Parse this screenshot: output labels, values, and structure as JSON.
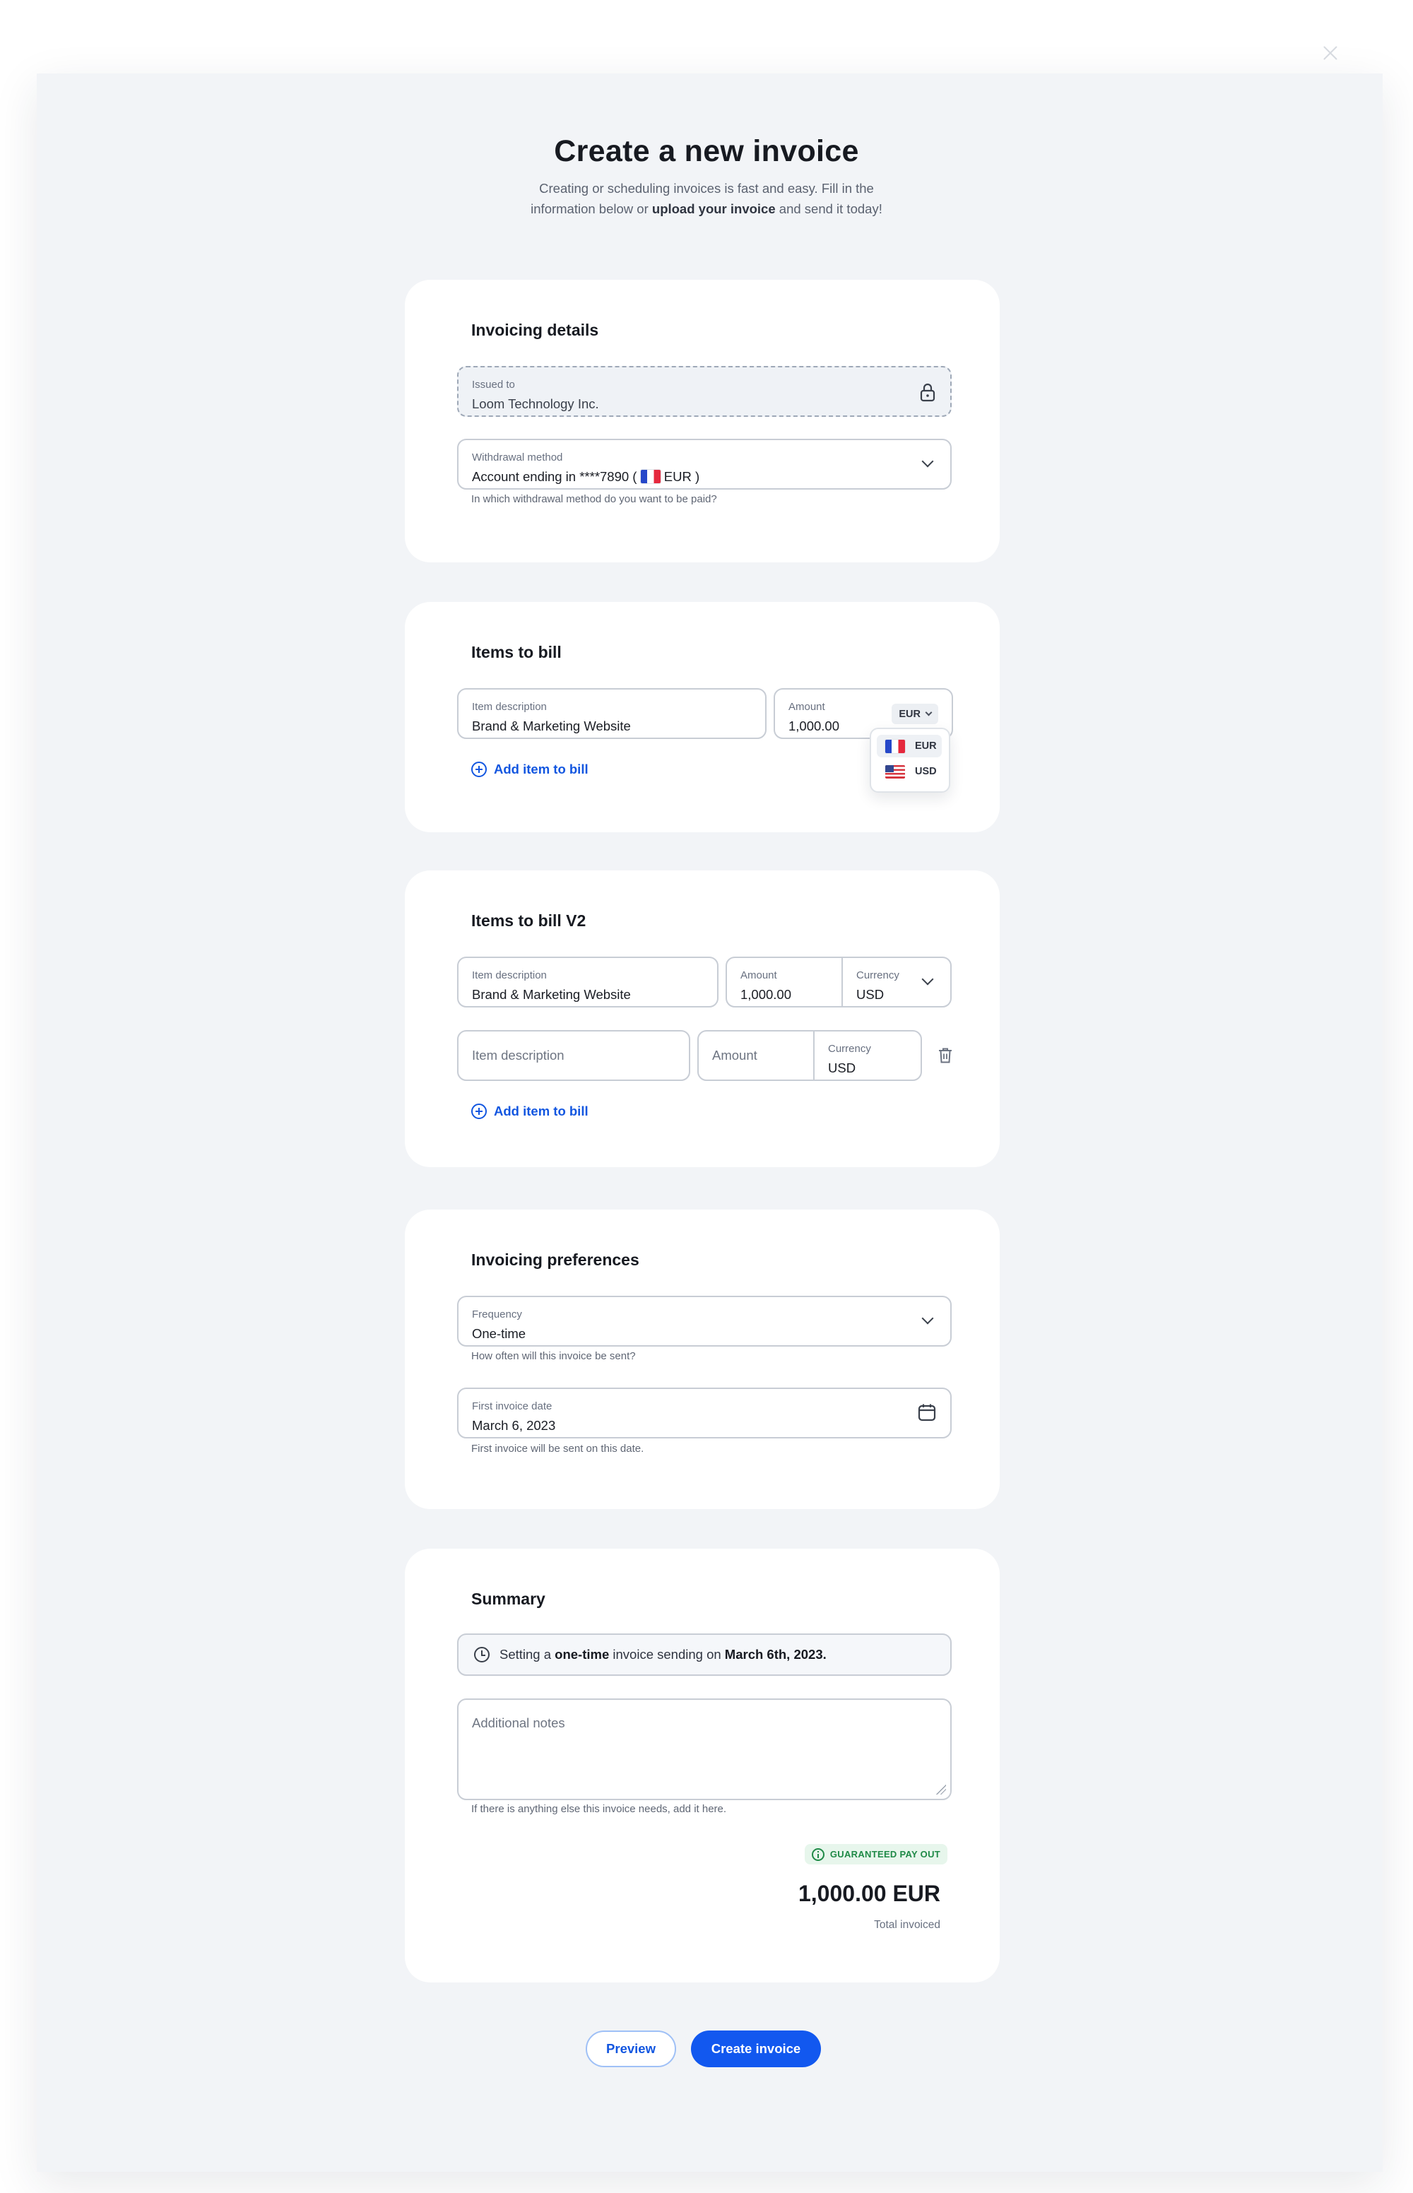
{
  "header": {
    "title": "Create a new invoice",
    "subtitle_line1": "Creating or scheduling invoices is fast and easy. Fill in the",
    "subtitle_line2_pre": "information below or ",
    "subtitle_line2_bold": "upload your invoice",
    "subtitle_line2_post": " and send it today!"
  },
  "invoicing_details": {
    "title": "Invoicing details",
    "issued_to": {
      "label": "Issued to",
      "value": "Loom Technology Inc.",
      "icon": "lock-icon"
    },
    "withdrawal": {
      "label": "Withdrawal method",
      "value_pre": "Account ending in ****7890 ( ",
      "value_currency": "EUR",
      "value_post": " )",
      "help": "In which withdrawal method do you want to be paid?"
    }
  },
  "items_to_bill": {
    "title": "Items to bill",
    "description": {
      "label": "Item description",
      "value": "Brand & Marketing Website"
    },
    "amount": {
      "label": "Amount",
      "value": "1,000.00",
      "currency": "EUR"
    },
    "currency_options": [
      "EUR",
      "USD"
    ],
    "add_label": "Add item to bill"
  },
  "items_to_bill_v2": {
    "title": "Items to bill V2",
    "row1": {
      "description_label": "Item description",
      "description_value": "Brand & Marketing Website",
      "amount_label": "Amount",
      "amount_value": "1,000.00",
      "currency_label": "Currency",
      "currency_value": "USD"
    },
    "row2": {
      "description_placeholder": "Item description",
      "amount_placeholder": "Amount",
      "currency_label": "Currency",
      "currency_value": "USD"
    },
    "add_label": "Add item to bill"
  },
  "preferences": {
    "title": "Invoicing preferences",
    "frequency": {
      "label": "Frequency",
      "value": "One-time",
      "help": "How often will this invoice be sent?"
    },
    "first_date": {
      "label": "First invoice date",
      "value": "March 6, 2023",
      "help": "First invoice will be sent on this date."
    }
  },
  "summary": {
    "title": "Summary",
    "note_pre": "Setting a ",
    "note_bold1": "one-time",
    "note_mid": " invoice sending on ",
    "note_bold2": "March 6th, 2023.",
    "notes_placeholder": "Additional notes",
    "notes_help": "If there is anything else this invoice needs, add it here.",
    "badge": "GUARANTEED PAY OUT",
    "total": "1,000.00 EUR",
    "total_label": "Total invoiced"
  },
  "actions": {
    "preview": "Preview",
    "create": "Create invoice"
  },
  "colors": {
    "accent": "#1258ef",
    "panel": "#f2f4f7",
    "success": "#1f8a47"
  }
}
